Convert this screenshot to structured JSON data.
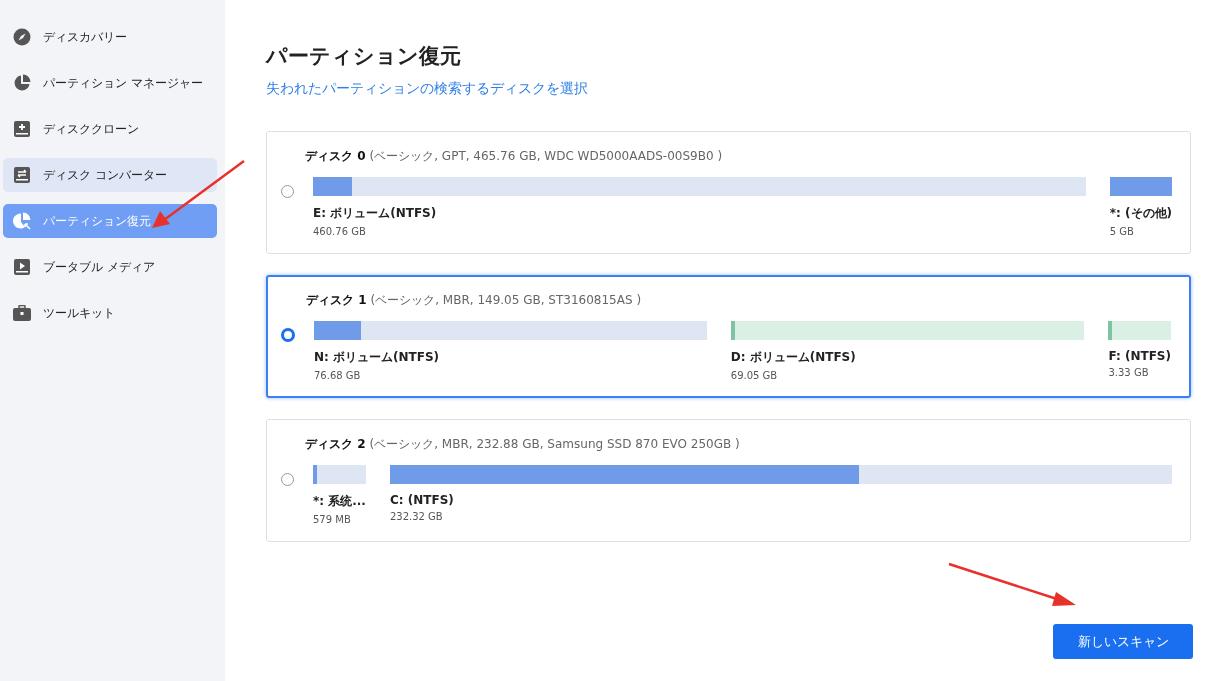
{
  "sidebar": {
    "items": [
      {
        "label": "ディスカバリー",
        "selected": false,
        "hovered": false
      },
      {
        "label": "パーティション マネージャー",
        "selected": false,
        "hovered": false
      },
      {
        "label": "ディスククローン",
        "selected": false,
        "hovered": false
      },
      {
        "label": "ディスク コンバーター",
        "selected": false,
        "hovered": true
      },
      {
        "label": "パーティション復元",
        "selected": true,
        "hovered": false
      },
      {
        "label": "ブータブル メディア",
        "selected": false,
        "hovered": false
      },
      {
        "label": "ツールキット",
        "selected": false,
        "hovered": false
      }
    ]
  },
  "main": {
    "title": "パーティション復元",
    "subtitle": "失われたパーティションの検索するディスクを選択",
    "disks": [
      {
        "name": "ディスク 0",
        "details": "(ベーシック, GPT, 465.76 GB, WDC WD5000AADS-00S9B0 )",
        "selected": false,
        "partitions": [
          {
            "label": "E: ボリューム(NTFS)",
            "size": "460.76 GB",
            "level": 0.05,
            "color": "#6f9be8"
          },
          {
            "label": "*: (その他)",
            "size": "5 GB",
            "level": 1,
            "color": "#6f9be8"
          }
        ]
      },
      {
        "name": "ディスク 1",
        "details": "(ベーシック, MBR, 149.05 GB, ST3160815AS )",
        "selected": true,
        "partitions": [
          {
            "label": "N: ボリューム(NTFS)",
            "size": "76.68 GB",
            "level": 0.12,
            "color": "#6f9be8"
          },
          {
            "label": "D: ボリューム(NTFS)",
            "size": "69.05 GB",
            "level": 0.01,
            "color": "#7fc4a2"
          },
          {
            "label": "F: (NTFS)",
            "size": "3.33 GB",
            "level": 0.03,
            "color": "#7fc4a2"
          }
        ]
      },
      {
        "name": "ディスク 2",
        "details": "(ベーシック, MBR, 232.88 GB, Samsung SSD 870 EVO 250GB )",
        "selected": false,
        "partitions": [
          {
            "label": "*: 系统...",
            "size": "579 MB",
            "level": 0.05,
            "color": "#6f9be8"
          },
          {
            "label": "C: (NTFS)",
            "size": "232.32 GB",
            "level": 0.6,
            "color": "#6f9be8"
          }
        ]
      }
    ],
    "scan_button": "新しいスキャン"
  }
}
